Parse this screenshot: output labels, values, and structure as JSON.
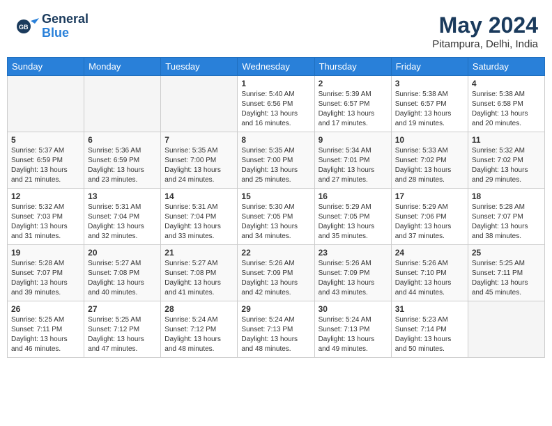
{
  "header": {
    "logo_line1": "General",
    "logo_line2": "Blue",
    "month_year": "May 2024",
    "location": "Pitampura, Delhi, India"
  },
  "days_of_week": [
    "Sunday",
    "Monday",
    "Tuesday",
    "Wednesday",
    "Thursday",
    "Friday",
    "Saturday"
  ],
  "weeks": [
    [
      {
        "day": "",
        "info": ""
      },
      {
        "day": "",
        "info": ""
      },
      {
        "day": "",
        "info": ""
      },
      {
        "day": "1",
        "info": "Sunrise: 5:40 AM\nSunset: 6:56 PM\nDaylight: 13 hours and 16 minutes."
      },
      {
        "day": "2",
        "info": "Sunrise: 5:39 AM\nSunset: 6:57 PM\nDaylight: 13 hours and 17 minutes."
      },
      {
        "day": "3",
        "info": "Sunrise: 5:38 AM\nSunset: 6:57 PM\nDaylight: 13 hours and 19 minutes."
      },
      {
        "day": "4",
        "info": "Sunrise: 5:38 AM\nSunset: 6:58 PM\nDaylight: 13 hours and 20 minutes."
      }
    ],
    [
      {
        "day": "5",
        "info": "Sunrise: 5:37 AM\nSunset: 6:59 PM\nDaylight: 13 hours and 21 minutes."
      },
      {
        "day": "6",
        "info": "Sunrise: 5:36 AM\nSunset: 6:59 PM\nDaylight: 13 hours and 23 minutes."
      },
      {
        "day": "7",
        "info": "Sunrise: 5:35 AM\nSunset: 7:00 PM\nDaylight: 13 hours and 24 minutes."
      },
      {
        "day": "8",
        "info": "Sunrise: 5:35 AM\nSunset: 7:00 PM\nDaylight: 13 hours and 25 minutes."
      },
      {
        "day": "9",
        "info": "Sunrise: 5:34 AM\nSunset: 7:01 PM\nDaylight: 13 hours and 27 minutes."
      },
      {
        "day": "10",
        "info": "Sunrise: 5:33 AM\nSunset: 7:02 PM\nDaylight: 13 hours and 28 minutes."
      },
      {
        "day": "11",
        "info": "Sunrise: 5:32 AM\nSunset: 7:02 PM\nDaylight: 13 hours and 29 minutes."
      }
    ],
    [
      {
        "day": "12",
        "info": "Sunrise: 5:32 AM\nSunset: 7:03 PM\nDaylight: 13 hours and 31 minutes."
      },
      {
        "day": "13",
        "info": "Sunrise: 5:31 AM\nSunset: 7:04 PM\nDaylight: 13 hours and 32 minutes."
      },
      {
        "day": "14",
        "info": "Sunrise: 5:31 AM\nSunset: 7:04 PM\nDaylight: 13 hours and 33 minutes."
      },
      {
        "day": "15",
        "info": "Sunrise: 5:30 AM\nSunset: 7:05 PM\nDaylight: 13 hours and 34 minutes."
      },
      {
        "day": "16",
        "info": "Sunrise: 5:29 AM\nSunset: 7:05 PM\nDaylight: 13 hours and 35 minutes."
      },
      {
        "day": "17",
        "info": "Sunrise: 5:29 AM\nSunset: 7:06 PM\nDaylight: 13 hours and 37 minutes."
      },
      {
        "day": "18",
        "info": "Sunrise: 5:28 AM\nSunset: 7:07 PM\nDaylight: 13 hours and 38 minutes."
      }
    ],
    [
      {
        "day": "19",
        "info": "Sunrise: 5:28 AM\nSunset: 7:07 PM\nDaylight: 13 hours and 39 minutes."
      },
      {
        "day": "20",
        "info": "Sunrise: 5:27 AM\nSunset: 7:08 PM\nDaylight: 13 hours and 40 minutes."
      },
      {
        "day": "21",
        "info": "Sunrise: 5:27 AM\nSunset: 7:08 PM\nDaylight: 13 hours and 41 minutes."
      },
      {
        "day": "22",
        "info": "Sunrise: 5:26 AM\nSunset: 7:09 PM\nDaylight: 13 hours and 42 minutes."
      },
      {
        "day": "23",
        "info": "Sunrise: 5:26 AM\nSunset: 7:09 PM\nDaylight: 13 hours and 43 minutes."
      },
      {
        "day": "24",
        "info": "Sunrise: 5:26 AM\nSunset: 7:10 PM\nDaylight: 13 hours and 44 minutes."
      },
      {
        "day": "25",
        "info": "Sunrise: 5:25 AM\nSunset: 7:11 PM\nDaylight: 13 hours and 45 minutes."
      }
    ],
    [
      {
        "day": "26",
        "info": "Sunrise: 5:25 AM\nSunset: 7:11 PM\nDaylight: 13 hours and 46 minutes."
      },
      {
        "day": "27",
        "info": "Sunrise: 5:25 AM\nSunset: 7:12 PM\nDaylight: 13 hours and 47 minutes."
      },
      {
        "day": "28",
        "info": "Sunrise: 5:24 AM\nSunset: 7:12 PM\nDaylight: 13 hours and 48 minutes."
      },
      {
        "day": "29",
        "info": "Sunrise: 5:24 AM\nSunset: 7:13 PM\nDaylight: 13 hours and 48 minutes."
      },
      {
        "day": "30",
        "info": "Sunrise: 5:24 AM\nSunset: 7:13 PM\nDaylight: 13 hours and 49 minutes."
      },
      {
        "day": "31",
        "info": "Sunrise: 5:23 AM\nSunset: 7:14 PM\nDaylight: 13 hours and 50 minutes."
      },
      {
        "day": "",
        "info": ""
      }
    ]
  ]
}
